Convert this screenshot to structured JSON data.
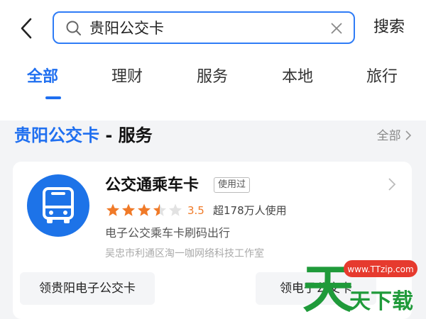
{
  "search": {
    "query": "贵阳公交卡",
    "button_label": "搜索"
  },
  "tabs": [
    {
      "label": "全部",
      "active": true
    },
    {
      "label": "理财"
    },
    {
      "label": "服务"
    },
    {
      "label": "本地"
    },
    {
      "label": "旅行"
    }
  ],
  "section": {
    "title_keyword": "贵阳公交卡",
    "title_suffix": " - 服务",
    "all_link": "全部"
  },
  "app": {
    "name": "公交通乘车卡",
    "badge": "使用过",
    "rating": "3.5",
    "rating_value": 3.5,
    "users": "超178万人使用",
    "description": "电子公交乘车卡刷码出行",
    "developer": "吴忠市利通区淘一咖网络科技工作室",
    "actions": [
      "领贵阳电子公交卡",
      "领电子公交卡"
    ],
    "icon": "bus-icon"
  },
  "watermark": {
    "site": "www.TTzip.com",
    "title": "天天下载"
  },
  "colors": {
    "accent": "#1f6ff0",
    "star": "#f07a28",
    "app_icon_bg": "#1d73e8"
  }
}
